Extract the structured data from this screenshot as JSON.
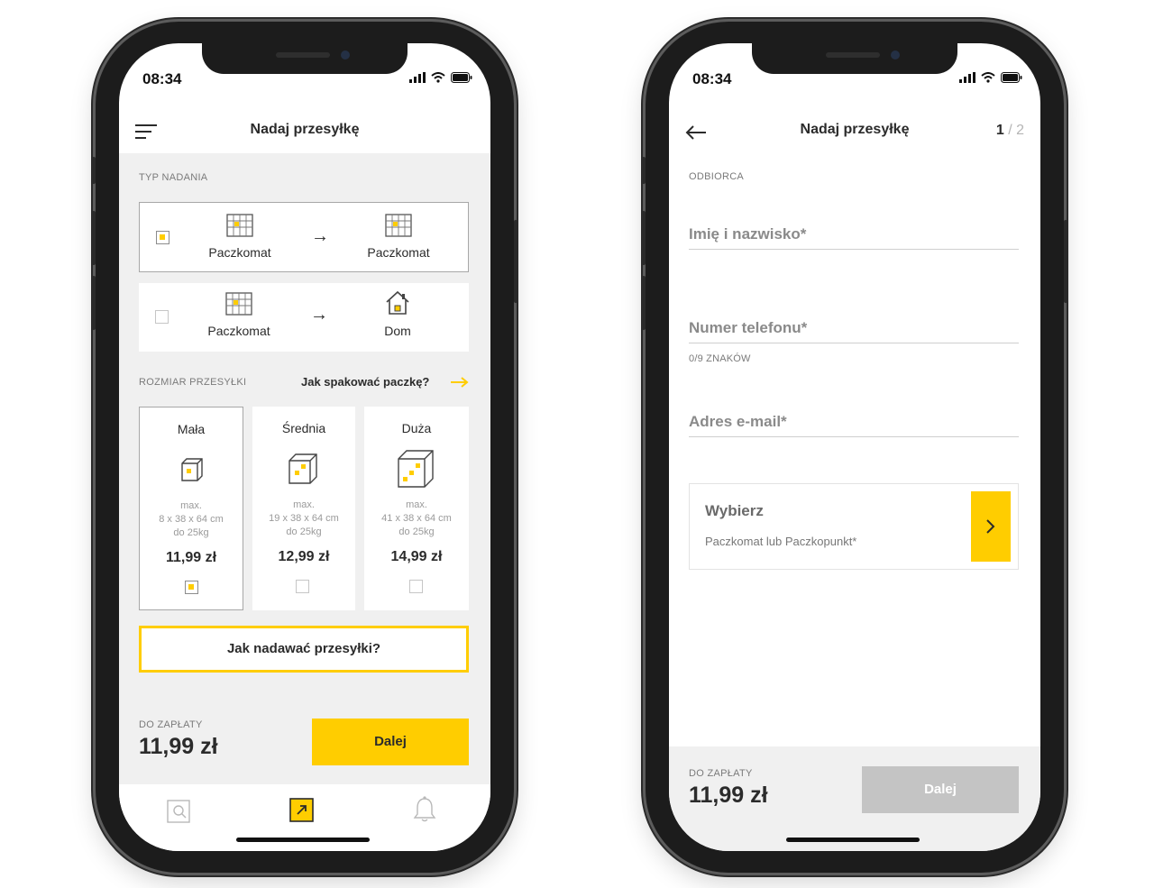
{
  "status_bar": {
    "time_left": "08:34",
    "time_right": "08:34"
  },
  "screen1": {
    "title": "Nadaj przesyłkę",
    "section_send_type": "TYP NADANIA",
    "options": [
      {
        "from": "Paczkomat",
        "to": "Paczkomat",
        "selected": true
      },
      {
        "from": "Paczkomat",
        "to": "Dom",
        "selected": false
      }
    ],
    "section_size": "ROZMIAR PRZESYŁKI",
    "pack_link": "Jak spakować paczkę?",
    "sizes": [
      {
        "name": "Mała",
        "max": "max.",
        "dims": "8 x 38 x 64 cm",
        "weight": "do 25kg",
        "price": "11,99 zł",
        "selected": true
      },
      {
        "name": "Średnia",
        "max": "max.",
        "dims": "19 x 38 x 64 cm",
        "weight": "do 25kg",
        "price": "12,99 zł",
        "selected": false
      },
      {
        "name": "Duża",
        "max": "max.",
        "dims": "41 x 38 x 64 cm",
        "weight": "do 25kg",
        "price": "14,99 zł",
        "selected": false
      }
    ],
    "how_to_button": "Jak nadawać przesyłki?",
    "pay_label": "DO ZAPŁATY",
    "pay_amount": "11,99 zł",
    "next_button": "Dalej",
    "tabs": [
      {
        "icon": "search-parcel-icon",
        "active": false
      },
      {
        "icon": "send-parcel-icon",
        "active": true
      },
      {
        "icon": "bell-icon",
        "active": false
      }
    ]
  },
  "screen2": {
    "title": "Nadaj przesyłkę",
    "step_current": "1",
    "step_total": "/ 2",
    "section_recipient": "ODBIORCA",
    "field_name": "Imię i nazwisko*",
    "field_phone": "Numer telefonu*",
    "phone_hint": "0/9 ZNAKÓW",
    "field_email": "Adres e-mail*",
    "picker_title": "Wybierz",
    "picker_subtitle": "Paczkomat lub Paczkopunkt*",
    "pay_label": "DO ZAPŁATY",
    "pay_amount": "11,99 zł",
    "next_button": "Dalej"
  },
  "colors": {
    "accent": "#ffcd00",
    "background": "#f0f0f0",
    "disabled": "#c4c4c4",
    "text": "#2b2b2b"
  }
}
